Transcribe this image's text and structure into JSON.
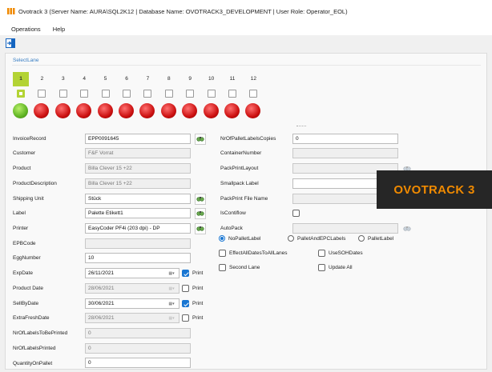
{
  "window": {
    "title": "Ovotrack 3 (Server Name: AURA\\SQL2K12 | Database Name: OVOTRACK3_DEVELOPMENT | User Role: Operator_EOL)"
  },
  "menu": {
    "items": [
      "Operations",
      "Help"
    ]
  },
  "toolbar": {
    "icon": "exit-icon"
  },
  "lanes": {
    "label": "SelectLane",
    "numbers": [
      "1",
      "2",
      "3",
      "4",
      "5",
      "6",
      "7",
      "8",
      "9",
      "10",
      "11",
      "12"
    ],
    "active_lane": 1,
    "status_colors": {
      "ok": "#5fb423",
      "error": "#cc1111"
    },
    "status": [
      "ok",
      "error",
      "error",
      "error",
      "error",
      "error",
      "error",
      "error",
      "error",
      "error",
      "error",
      "error"
    ]
  },
  "form_left": {
    "invoice_record": {
      "label": "InvoiceRecord",
      "value": "EPP0091645"
    },
    "customer": {
      "label": "Customer",
      "value": "F&F Vorrat"
    },
    "product": {
      "label": "Product",
      "value": "Billa Clever 15 +22"
    },
    "product_description": {
      "label": "ProductDescription",
      "value": "Billa Clever 15 +22"
    },
    "shipping_unit": {
      "label": "Shipping Unit",
      "value": "Stück"
    },
    "label_field": {
      "label": "Label",
      "value": "Palette Etikett1"
    },
    "printer": {
      "label": "Printer",
      "value": "EasyCoder PF4i (203 dpi) - DP"
    },
    "epb_code": {
      "label": "EPBCode",
      "value": ""
    },
    "egg_number": {
      "label": "EggNumber",
      "value": "10"
    },
    "exp_date": {
      "label": "ExpDate",
      "value": "26/11/2021",
      "print_label": "Print",
      "print": true
    },
    "product_date": {
      "label": "Product Date",
      "value": "28/06/2021",
      "print_label": "Print",
      "print": false
    },
    "sell_by_date": {
      "label": "SellByDate",
      "value": "30/06/2021",
      "print_label": "Print",
      "print": true
    },
    "extra_fresh_date": {
      "label": "ExtraFreshDate",
      "value": "28/06/2021",
      "print_label": "Print",
      "print": false
    },
    "nr_labels_to_print": {
      "label": "NrOfLabelsToBePrinted",
      "value": "0"
    },
    "nr_labels_printed": {
      "label": "NrOfLabelsPrinted",
      "value": "0"
    },
    "quantity_on_pallet": {
      "label": "QuantityOnPallet",
      "value": "0"
    }
  },
  "form_right": {
    "nr_pallet_label_copies": {
      "label": "NrOfPalletLabelsCopies",
      "value": "0"
    },
    "container_number": {
      "label": "ContainerNumber",
      "value": ""
    },
    "pack_print_layout": {
      "label": "PackPrintLayout",
      "value": ""
    },
    "smallpack_label": {
      "label": "Smallpack Label",
      "value": ""
    },
    "pack_print_file_name": {
      "label": "PackPrint File Name",
      "value": ""
    },
    "is_contiflow": {
      "label": "IsContiflow",
      "checked": false
    },
    "auto_pack": {
      "label": "AutoPack",
      "value": ""
    },
    "radios": [
      {
        "label": "NoPalletLabel",
        "selected": true
      },
      {
        "label": "PalletAndEPCLabels",
        "selected": false
      },
      {
        "label": "PalletLabel",
        "selected": false
      }
    ],
    "checks": [
      {
        "label": "EffectAllDatesToAllLanes",
        "checked": false
      },
      {
        "label": "UseSOHDates",
        "checked": false
      },
      {
        "label": "Second Lane",
        "checked": false
      },
      {
        "label": "Update All",
        "checked": false
      }
    ]
  },
  "brand": {
    "text": "OVOTRACK 3",
    "bg": "#262626",
    "color": "#f08a00"
  }
}
